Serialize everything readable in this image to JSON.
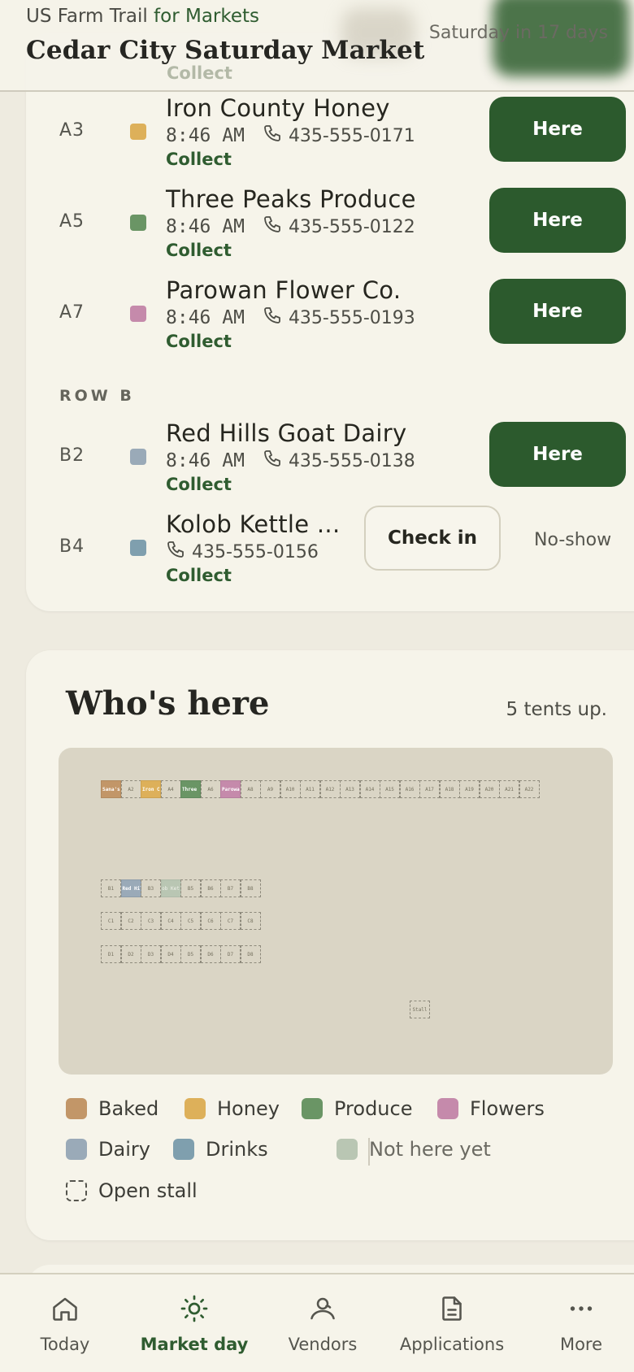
{
  "header": {
    "brand": "US Farm Trail",
    "brand_suffix": " for Markets",
    "title": "Cedar City Saturday Market",
    "countdown": "Saturday in 17 days",
    "ghost_action": "Collect"
  },
  "arrivals": {
    "rows": [
      {
        "stall": "A3",
        "name": "Iron County Honey",
        "time": "8:46 AM",
        "phone": "435-555-0171",
        "action": "Collect",
        "button": "Here",
        "color": "#ddb05a"
      },
      {
        "stall": "A5",
        "name": "Three Peaks Produce",
        "time": "8:46 AM",
        "phone": "435-555-0122",
        "action": "Collect",
        "button": "Here",
        "color": "#6a9565"
      },
      {
        "stall": "A7",
        "name": "Parowan Flower Co.",
        "time": "8:46 AM",
        "phone": "435-555-0193",
        "action": "Collect",
        "button": "Here",
        "color": "#c58aab"
      }
    ],
    "row_b_label": "ROW B",
    "row_b": [
      {
        "stall": "B2",
        "name": "Red Hills Goat Dairy",
        "time": "8:46 AM",
        "phone": "435-555-0138",
        "action": "Collect",
        "button": "Here",
        "color": "#9aaab8"
      },
      {
        "stall": "B4",
        "name": "Kolob Kettle ...",
        "phone": "435-555-0156",
        "action": "Collect",
        "checkin": "Check in",
        "noshow": "No-show",
        "color": "#7f9fae"
      }
    ]
  },
  "whos_here": {
    "title": "Who's here",
    "count": "5 tents up.",
    "map": {
      "row_a": [
        {
          "label": "Sana's Sour",
          "color": "#c29668"
        },
        {
          "label": "A2"
        },
        {
          "label": "Iron Coun",
          "color": "#ddb05a"
        },
        {
          "label": "A4"
        },
        {
          "label": "Three Pea",
          "color": "#6a9565"
        },
        {
          "label": "A6"
        },
        {
          "label": "Parowan Fl",
          "color": "#c58aab"
        },
        {
          "label": "A8"
        },
        {
          "label": "A9"
        },
        {
          "label": "A10"
        },
        {
          "label": "A11"
        },
        {
          "label": "A12"
        },
        {
          "label": "A13"
        },
        {
          "label": "A14"
        },
        {
          "label": "A15"
        },
        {
          "label": "A16"
        },
        {
          "label": "A17"
        },
        {
          "label": "A18"
        },
        {
          "label": "A19"
        },
        {
          "label": "A20"
        },
        {
          "label": "A21"
        },
        {
          "label": "A22"
        }
      ],
      "row_b": [
        {
          "label": "B1"
        },
        {
          "label": "Red Hill",
          "color": "#9aaab8"
        },
        {
          "label": "B3"
        },
        {
          "label": "ob Ket",
          "color": "#b9c6b3",
          "pending": true
        },
        {
          "label": "B5"
        },
        {
          "label": "B6"
        },
        {
          "label": "B7"
        },
        {
          "label": "B8"
        }
      ],
      "row_c": [
        {
          "label": "C1"
        },
        {
          "label": "C2"
        },
        {
          "label": "C3"
        },
        {
          "label": "C4"
        },
        {
          "label": "C5"
        },
        {
          "label": "C6"
        },
        {
          "label": "C7"
        },
        {
          "label": "C8"
        }
      ],
      "row_d": [
        {
          "label": "D1"
        },
        {
          "label": "D2"
        },
        {
          "label": "D3"
        },
        {
          "label": "D4"
        },
        {
          "label": "D5"
        },
        {
          "label": "D6"
        },
        {
          "label": "D7"
        },
        {
          "label": "D8"
        }
      ],
      "extra": {
        "label": "Stall"
      }
    },
    "legend": [
      {
        "label": "Baked",
        "color": "#c29668"
      },
      {
        "label": "Honey",
        "color": "#ddb05a"
      },
      {
        "label": "Produce",
        "color": "#6a9565"
      },
      {
        "label": "Flowers",
        "color": "#c58aab"
      },
      {
        "label": "Dairy",
        "color": "#9aaab8"
      },
      {
        "label": "Drinks",
        "color": "#7f9fae"
      },
      {
        "label": "Not here yet",
        "color": "#b9c6b3"
      },
      {
        "label": "Open stall"
      }
    ]
  },
  "nav": {
    "items": [
      {
        "label": "Today",
        "icon": "home-icon"
      },
      {
        "label": "Market day",
        "icon": "sun-icon",
        "active": true
      },
      {
        "label": "Vendors",
        "icon": "vendors-icon"
      },
      {
        "label": "Applications",
        "icon": "document-icon"
      },
      {
        "label": "More",
        "icon": "more-icon"
      }
    ]
  },
  "colors": {
    "accent": "#2c5a2d",
    "background": "#eeebe0",
    "card": "#f6f4ea"
  }
}
